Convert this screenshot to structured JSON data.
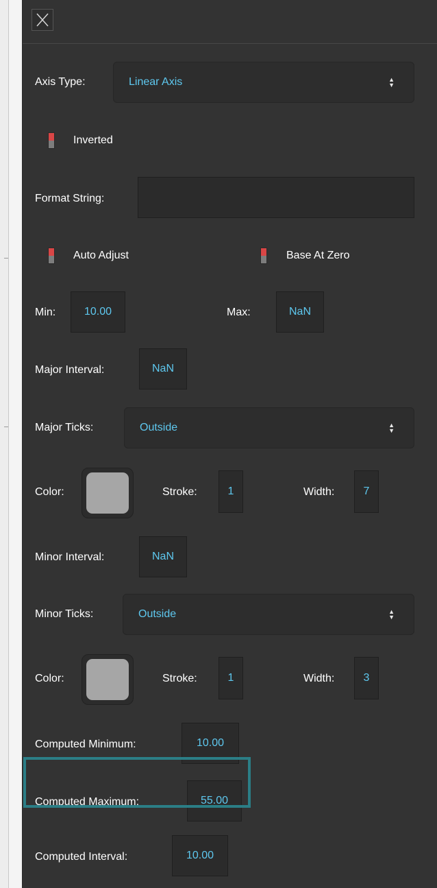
{
  "panel": {
    "close_icon": "close-x-icon",
    "axis_type": {
      "label": "Axis Type:",
      "value": "Linear Axis"
    },
    "inverted": {
      "label": "Inverted",
      "checked": false
    },
    "format_string": {
      "label": "Format String:",
      "value": ""
    },
    "auto_adjust": {
      "label": "Auto Adjust",
      "checked": false
    },
    "base_at_zero": {
      "label": "Base At Zero",
      "checked": false
    },
    "min": {
      "label": "Min:",
      "value": "10.00"
    },
    "max": {
      "label": "Max:",
      "value": "NaN"
    },
    "major_interval": {
      "label": "Major Interval:",
      "value": "NaN"
    },
    "major_ticks": {
      "label": "Major Ticks:",
      "value": "Outside",
      "color_label": "Color:",
      "color": "#a6a6a6",
      "stroke_label": "Stroke:",
      "stroke": "1",
      "width_label": "Width:",
      "width": "7"
    },
    "minor_interval": {
      "label": "Minor Interval:",
      "value": "NaN"
    },
    "minor_ticks": {
      "label": "Minor Ticks:",
      "value": "Outside",
      "color_label": "Color:",
      "color": "#a6a6a6",
      "stroke_label": "Stroke:",
      "stroke": "1",
      "width_label": "Width:",
      "width": "3"
    },
    "computed_minimum": {
      "label": "Computed Minimum:",
      "value": "10.00"
    },
    "computed_maximum": {
      "label": "Computed Maximum:",
      "value": "55.00"
    },
    "computed_interval": {
      "label": "Computed Interval:",
      "value": "10.00"
    }
  },
  "colors": {
    "panel_bg": "#333333",
    "value_text": "#5ec8ef",
    "highlight_border": "#2b7e86",
    "checkbox_red": "#d94646"
  }
}
